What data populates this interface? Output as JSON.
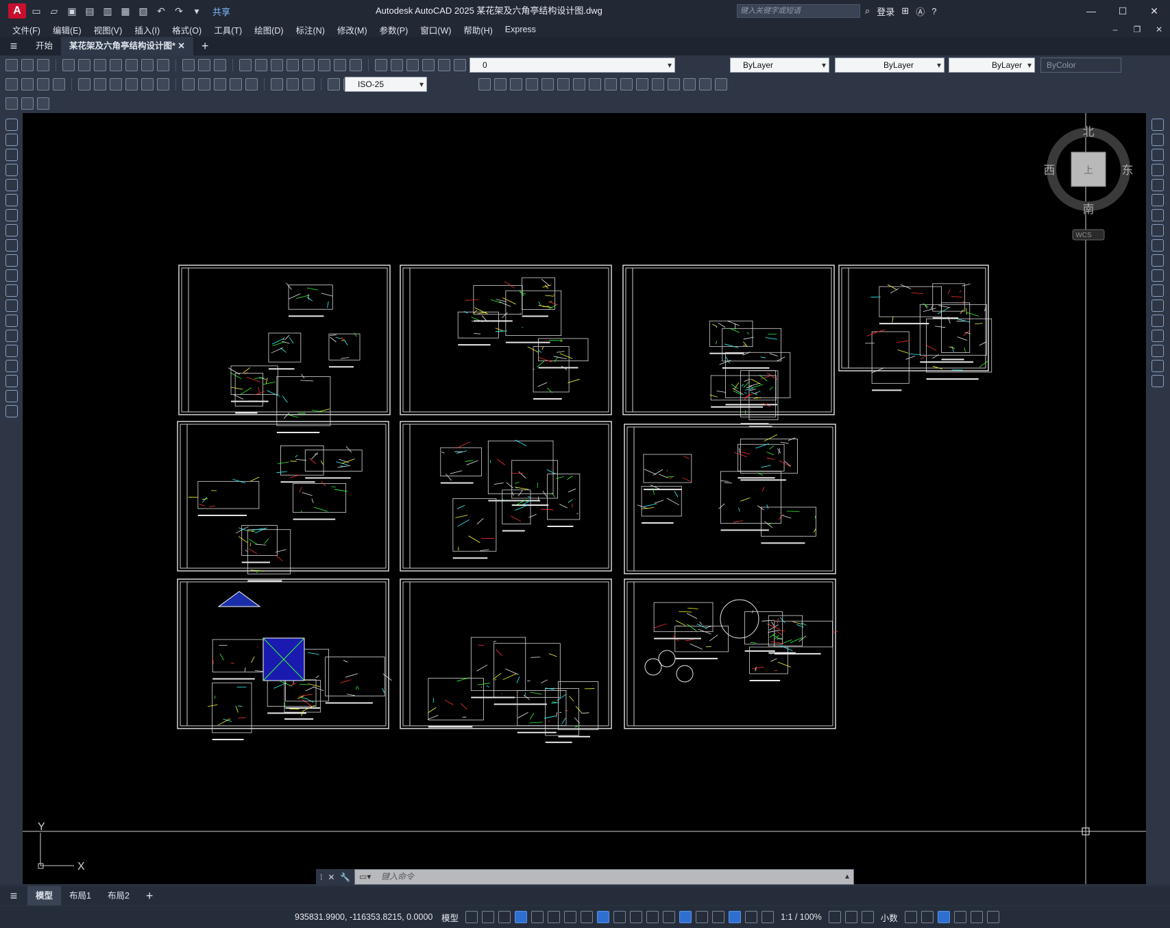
{
  "app": {
    "logo": "A",
    "title": "Autodesk AutoCAD 2025    某花架及六角亭结构设计图.dwg",
    "share": "共享",
    "search_placeholder": "键入关键字或短语",
    "login": "登录"
  },
  "window_controls": {
    "minimize": "—",
    "maximize": "☐",
    "close": "✕"
  },
  "menu": [
    "文件(F)",
    "编辑(E)",
    "视图(V)",
    "插入(I)",
    "格式(O)",
    "工具(T)",
    "绘图(D)",
    "标注(N)",
    "修改(M)",
    "参数(P)",
    "窗口(W)",
    "帮助(H)",
    "Express"
  ],
  "tabs": {
    "start": "开始",
    "document": "某花架及六角亭结构设计图*",
    "add": "+"
  },
  "layer": {
    "current": "0"
  },
  "properties": {
    "color": "ByLayer",
    "linetype": "ByLayer",
    "lineweight": "ByLayer",
    "plotstyle": "ByColor"
  },
  "dimstyle": "ISO-25",
  "viewcube": {
    "north": "北",
    "south": "南",
    "east": "东",
    "west": "西",
    "face": "上",
    "wcs": "WCS"
  },
  "ucs": {
    "x": "X",
    "y": "Y"
  },
  "command": {
    "placeholder": "键入命令"
  },
  "layout_tabs": [
    "模型",
    "布局1",
    "布局2"
  ],
  "status": {
    "coords": "935831.9900, -116353.8215, 0.0000",
    "model": "模型",
    "scale": "1:1 / 100%",
    "units": "小数"
  },
  "colors": {
    "accent": "#2f6fd0",
    "logo": "#c8102e",
    "canvas": "#000000"
  }
}
